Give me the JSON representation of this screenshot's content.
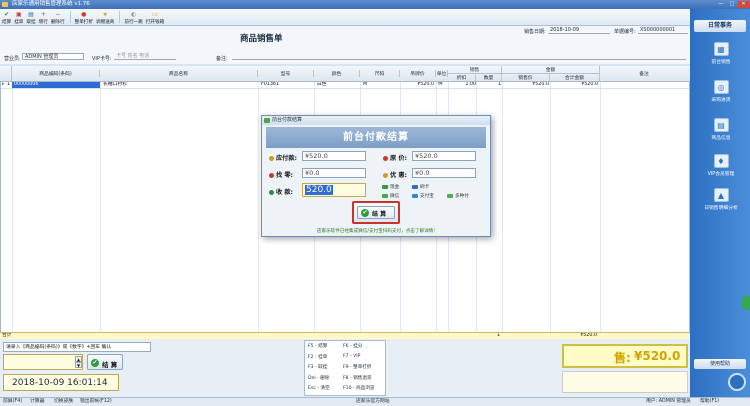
{
  "window": {
    "title": "店家乐通用销售管理系统 v1.76",
    "min": "—",
    "max": "□",
    "close": "✕"
  },
  "toolbar": {
    "items": [
      {
        "label": "结算",
        "color": "#2e8b3e",
        "glyph": "✔"
      },
      {
        "label": "挂单",
        "color": "#c0392b",
        "glyph": "▣"
      },
      {
        "label": "取挂",
        "color": "#2d6fc0",
        "glyph": "▤"
      },
      {
        "label": "增行",
        "color": "#2d6fc0",
        "glyph": "+"
      },
      {
        "label": "删除行",
        "color": "#5b6f86",
        "glyph": "−"
      },
      {
        "label": "整单打折",
        "color": "#d13b2b",
        "glyph": "●"
      },
      {
        "label": "调赠送商",
        "color": "#d49b1c",
        "glyph": "★"
      },
      {
        "label": "前行一跳",
        "color": "#8a9aab",
        "glyph": "◐"
      },
      {
        "label": "打开钱箱",
        "color": "#d8a23a",
        "glyph": "▭"
      }
    ]
  },
  "form": {
    "title": "商品销售单",
    "date_label": "销售日期:",
    "date_value": "2018-10-09",
    "order_label": "单据编号:",
    "order_value": "XS000000001",
    "salesman_label": "营业员:",
    "salesman_value": "ADMIN 管理员",
    "vip_label": "VIP卡号:",
    "vip_placeholder": "卡号 姓名 电话",
    "remark_label": "备注:",
    "remark_value": ""
  },
  "grid": {
    "headers": {
      "code": "商品编码(条码)",
      "name": "商品名称",
      "model": "型号",
      "color": "颜色",
      "size": "尺码",
      "price": "吊牌价",
      "unit": "单位",
      "sale_group": "销售",
      "discount": "折扣",
      "qty": "数量",
      "amount_group": "金额",
      "sale_price": "销售价",
      "subtotal": "合计金额",
      "remark": "备注"
    },
    "rows": [
      {
        "marker": "▸",
        "idx": "1",
        "code": "00000006",
        "name": "长袖口衬衫",
        "model": "F01361",
        "color": "白色",
        "size": "M",
        "price": "¥520.0",
        "unit": "件",
        "discount": "1.00",
        "qty": "1",
        "sale_price": "¥520.0",
        "subtotal": "¥520.0",
        "remark": ""
      }
    ],
    "sum": {
      "label": "合计",
      "qty": "1",
      "subtotal": "¥520.0"
    }
  },
  "bottom": {
    "hint": "请录入《商品编码(条码)》或《数字》+回车 确认",
    "input_value": "",
    "settle_label": "结 算",
    "datetime": "2018-10-09 16:01:14",
    "shortcuts": [
      "F5 - 结算",
      "F6 - 挂分",
      "F2 - 挂单",
      "F7 - VIP",
      "F3 - 取挂",
      "F9 - 整单打折",
      "Del - 删除",
      "F8 - 销售退货",
      "Esc - 清空",
      "F10 - 商品浏览"
    ],
    "total_label": "售:",
    "total_value": "¥520.0"
  },
  "rightpanel": {
    "header": "日常事务",
    "items": [
      {
        "label": "前台销售",
        "glyph": "▦"
      },
      {
        "label": "采购进货",
        "glyph": "◎"
      },
      {
        "label": "商品信息",
        "glyph": "▤"
      },
      {
        "label": "VIP会员管理",
        "glyph": "♦"
      },
      {
        "label": "日销售明细分析",
        "glyph": "▲"
      }
    ],
    "footer": "使用帮助"
  },
  "status": {
    "left": "前屏(F4)",
    "calc": "计算器",
    "switch": "切换皮肤",
    "lock": "锁出前帐(F12)",
    "center": "店家乐官方网站",
    "user": "用户: ADMIN 管理员",
    "help": "帮助(F1)"
  },
  "dialog": {
    "title": "前台付款结算",
    "banner": "前台付款结算",
    "due_label": "应付款:",
    "due_value": "¥520.0",
    "orig_label": "原  价:",
    "orig_value": "¥520.0",
    "change_label": "找  零:",
    "change_value": "¥0.0",
    "discount_label": "优  惠:",
    "discount_value": "¥0.0",
    "received_label": "收  款:",
    "received_value": "520.0",
    "pay_methods": [
      {
        "label": "现金",
        "color": "#3a9a3a"
      },
      {
        "label": "刷卡",
        "color": "#2d6fc0"
      },
      {
        "label": "微信",
        "color": "#4aa64a"
      },
      {
        "label": "支付宝",
        "color": "#2d8ad6"
      },
      {
        "label": "多种付",
        "color": "#55aa55"
      }
    ],
    "settle_label": "结 算",
    "tip": "店家乐软件已经集成微信/支付宝扫码支付，点击了解详情!"
  }
}
